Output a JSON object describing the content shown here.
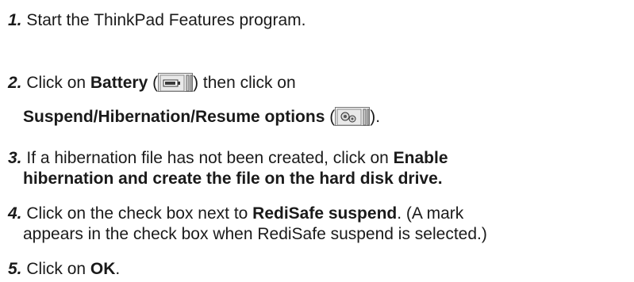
{
  "steps": [
    {
      "num": "1.",
      "lines": [
        {
          "parts": [
            "Start the ThinkPad Features program."
          ]
        }
      ]
    },
    {
      "num": "2.",
      "lines": [
        {
          "parts": [
            "Click on ",
            "Battery",
            " (",
            ") then click on"
          ]
        },
        {
          "parts": [
            "Suspend/Hibernation/Resume options",
            " (",
            ")."
          ]
        }
      ]
    },
    {
      "num": "3.",
      "lines": [
        {
          "parts": [
            "If a hibernation file has not been created, click on ",
            "Enable"
          ]
        },
        {
          "parts": [
            "hibernation and create the file on the hard disk drive."
          ]
        }
      ]
    },
    {
      "num": "4.",
      "lines": [
        {
          "parts": [
            "Click on the check box next to ",
            "RediSafe suspend",
            ".  (A mark"
          ]
        },
        {
          "parts": [
            "appears in the check box when RediSafe suspend is selected.)"
          ]
        }
      ]
    },
    {
      "num": "5.",
      "lines": [
        {
          "parts": [
            "Click on ",
            "OK",
            "."
          ]
        }
      ]
    }
  ],
  "icons": {
    "battery": "battery-icon",
    "suspend": "suspend-options-icon"
  }
}
